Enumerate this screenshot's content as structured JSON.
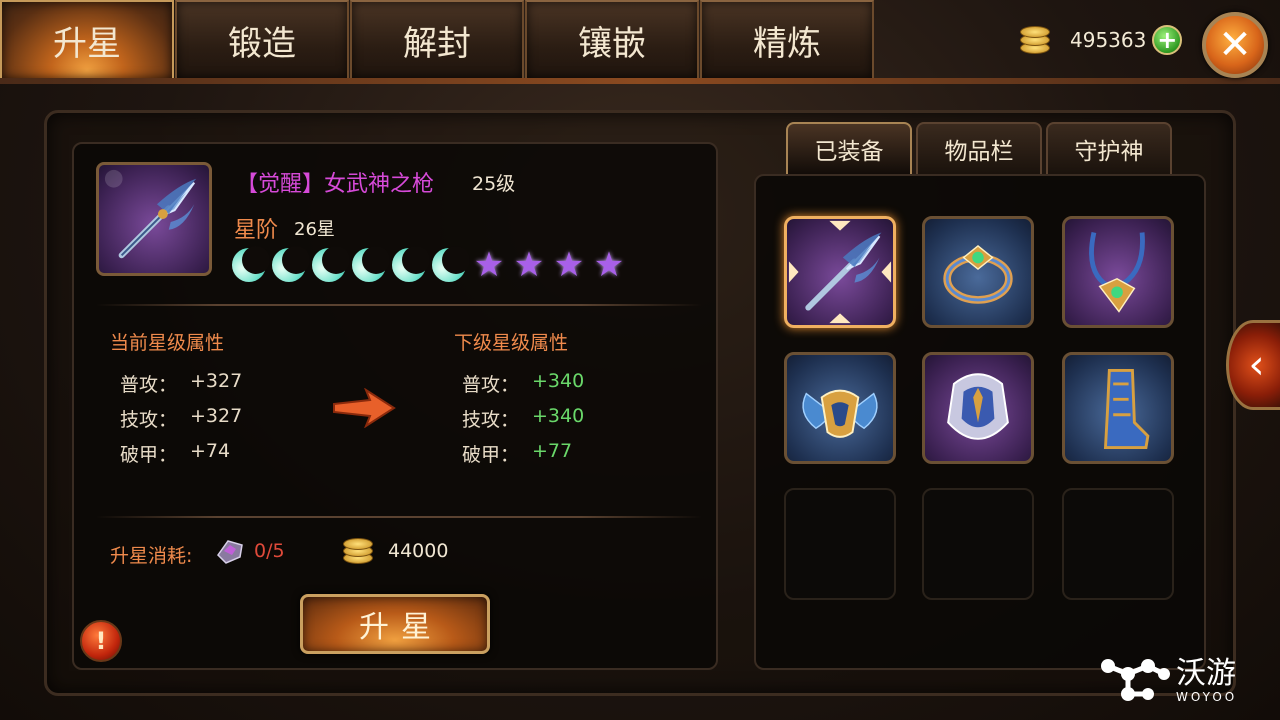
{
  "top_tabs": [
    "升星",
    "锻造",
    "解封",
    "镶嵌",
    "精炼"
  ],
  "currency": {
    "gold": "495363",
    "add_symbol": "+"
  },
  "close_symbol": "✕",
  "item": {
    "name": "【觉醒】女武神之枪",
    "level": "25级",
    "star_label": "星阶",
    "star_value": "26星",
    "star_progress": {
      "moons": 6,
      "stars": 4
    }
  },
  "current_attrs": {
    "title": "当前星级属性",
    "rows": [
      {
        "label": "普攻：",
        "value": "+327"
      },
      {
        "label": "技攻：",
        "value": "+327"
      },
      {
        "label": "破甲：",
        "value": "+74"
      }
    ]
  },
  "next_attrs": {
    "title": "下级星级属性",
    "rows": [
      {
        "label": "普攻：",
        "value": "+340"
      },
      {
        "label": "技攻：",
        "value": "+340"
      },
      {
        "label": "破甲：",
        "value": "+77"
      }
    ]
  },
  "cost": {
    "label": "升星消耗:",
    "gem": "0/5",
    "gold": "44000"
  },
  "upgrade_button": "升星",
  "info_symbol": "!",
  "right_tabs": [
    "已装备",
    "物品栏",
    "守护神"
  ],
  "side_button_symbol": "‹",
  "watermark": {
    "cn": "沃游",
    "en": "WOYOO"
  },
  "colors": {
    "accent_orange": "#ef8a4c",
    "item_purple": "#d64ad8",
    "value_green": "#6ad86a",
    "cost_red": "#e04a3a"
  }
}
